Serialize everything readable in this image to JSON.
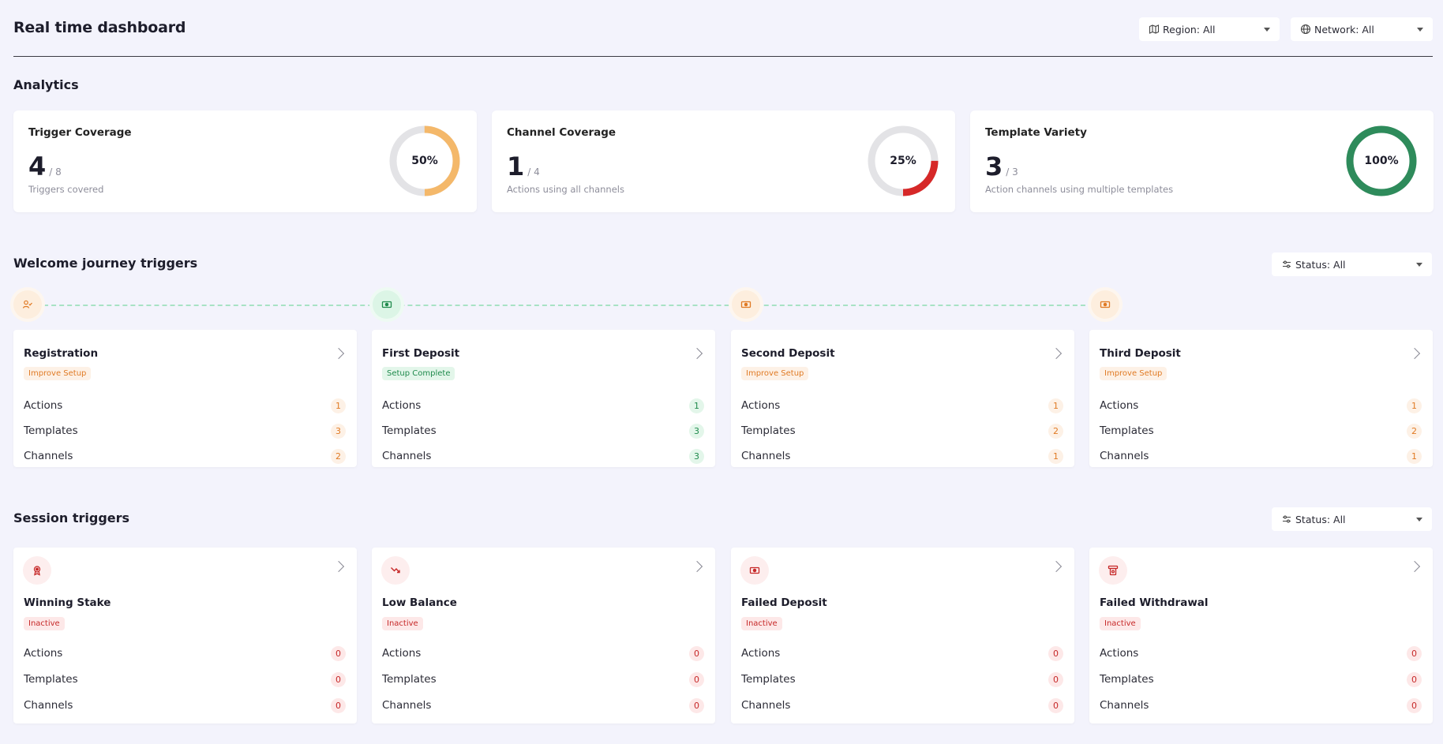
{
  "header": {
    "title": "Real time dashboard",
    "region_filter": "Region: All",
    "network_filter": "Network: All"
  },
  "analytics": {
    "title": "Analytics",
    "cards": [
      {
        "title": "Trigger Coverage",
        "value": "4",
        "of": "/ 8",
        "subtitle": "Triggers covered",
        "percent_label": "50%",
        "percent": 50,
        "color": "#f4b86a"
      },
      {
        "title": "Channel Coverage",
        "value": "1",
        "of": "/ 4",
        "subtitle": "Actions using all channels",
        "percent_label": "25%",
        "percent": 25,
        "color": "#d62828"
      },
      {
        "title": "Template Variety",
        "value": "3",
        "of": "/ 3",
        "subtitle": "Action channels using multiple templates",
        "percent_label": "100%",
        "percent": 100,
        "color": "#2e8b5b"
      }
    ]
  },
  "welcome": {
    "title": "Welcome journey triggers",
    "status_filter": "Status: All",
    "cards": [
      {
        "title": "Registration",
        "status": "Improve Setup",
        "tone": "orange",
        "actions_label": "Actions",
        "actions": "1",
        "templates_label": "Templates",
        "templates": "3",
        "channels_label": "Channels",
        "channels": "2",
        "icon": "user-check-icon"
      },
      {
        "title": "First Deposit",
        "status": "Setup Complete",
        "tone": "green",
        "actions_label": "Actions",
        "actions": "1",
        "templates_label": "Templates",
        "templates": "3",
        "channels_label": "Channels",
        "channels": "3",
        "icon": "cash-icon"
      },
      {
        "title": "Second Deposit",
        "status": "Improve Setup",
        "tone": "orange",
        "actions_label": "Actions",
        "actions": "1",
        "templates_label": "Templates",
        "templates": "2",
        "channels_label": "Channels",
        "channels": "1",
        "icon": "cash-icon"
      },
      {
        "title": "Third Deposit",
        "status": "Improve Setup",
        "tone": "orange",
        "actions_label": "Actions",
        "actions": "1",
        "templates_label": "Templates",
        "templates": "2",
        "channels_label": "Channels",
        "channels": "1",
        "icon": "cash-icon"
      }
    ]
  },
  "session": {
    "title": "Session triggers",
    "status_filter": "Status: All",
    "cards": [
      {
        "title": "Winning Stake",
        "status": "Inactive",
        "actions_label": "Actions",
        "actions": "0",
        "templates_label": "Templates",
        "templates": "0",
        "channels_label": "Channels",
        "channels": "0",
        "icon": "award-icon"
      },
      {
        "title": "Low Balance",
        "status": "Inactive",
        "actions_label": "Actions",
        "actions": "0",
        "templates_label": "Templates",
        "templates": "0",
        "channels_label": "Channels",
        "channels": "0",
        "icon": "trending-down-icon"
      },
      {
        "title": "Failed Deposit",
        "status": "Inactive",
        "actions_label": "Actions",
        "actions": "0",
        "templates_label": "Templates",
        "templates": "0",
        "channels_label": "Channels",
        "channels": "0",
        "icon": "cash-icon"
      },
      {
        "title": "Failed Withdrawal",
        "status": "Inactive",
        "actions_label": "Actions",
        "actions": "0",
        "templates_label": "Templates",
        "templates": "0",
        "channels_label": "Channels",
        "channels": "0",
        "icon": "atm-icon"
      }
    ]
  }
}
